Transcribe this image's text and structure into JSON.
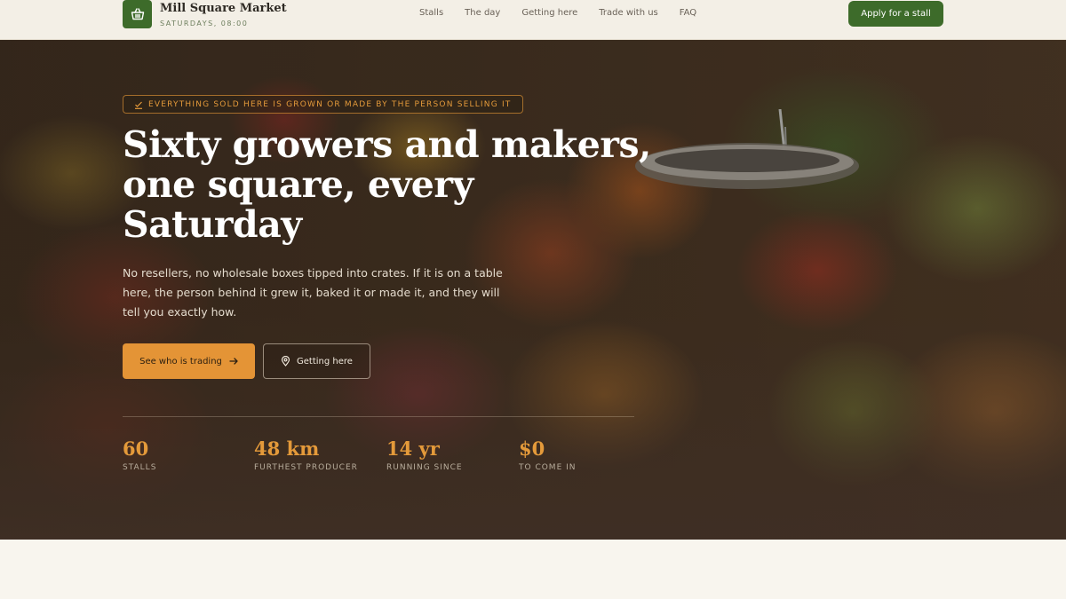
{
  "header": {
    "brand_name": "Mill Square Market",
    "brand_sub": "SATURDAYS, 08:00",
    "logo_icon": "basket-icon",
    "nav": [
      "Stalls",
      "The day",
      "Getting here",
      "Trade with us",
      "FAQ"
    ],
    "cta_label": "Apply for a stall"
  },
  "hero": {
    "tagline": "EVERYTHING SOLD HERE IS GROWN OR MADE BY THE PERSON SELLING IT",
    "headline": "Sixty growers and makers, one square, every Saturday",
    "lede": "No resellers, no wholesale boxes tipped into crates. If it is on a table here, the person behind it grew it, baked it or made it, and they will tell you exactly how.",
    "primary_label": "See who is trading",
    "secondary_label": "Getting here",
    "stats": [
      {
        "value": "60",
        "label": "STALLS"
      },
      {
        "value": "48 km",
        "label": "FURTHEST PRODUCER"
      },
      {
        "value": "14 yr",
        "label": "RUNNING SINCE"
      },
      {
        "value": "$0",
        "label": "TO COME IN"
      }
    ]
  },
  "colors": {
    "brand_green": "#3d6b2a",
    "accent_orange": "#e49436",
    "page_background": "#f8f5ee"
  }
}
